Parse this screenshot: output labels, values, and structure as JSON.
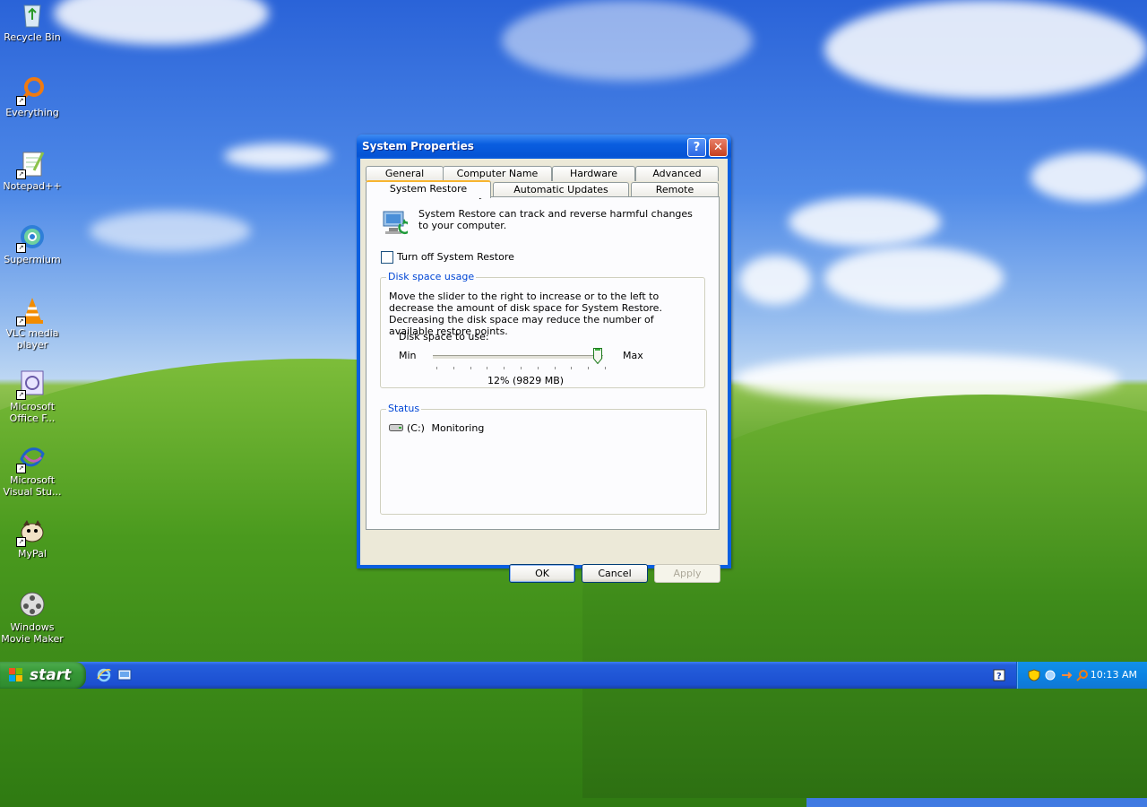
{
  "desktop": {
    "icons": [
      {
        "label": "Recycle Bin",
        "icon": "recycle-bin-icon"
      },
      {
        "label": "Everything",
        "icon": "everything-search-icon"
      },
      {
        "label": "Notepad++",
        "icon": "notepad-plus-plus-icon"
      },
      {
        "label": "Supermium",
        "icon": "supermium-browser-icon"
      },
      {
        "label": "VLC media player",
        "icon": "vlc-cone-icon"
      },
      {
        "label": "Microsoft Office F...",
        "icon": "office-file-icon"
      },
      {
        "label": "Microsoft Visual Stu...",
        "icon": "visual-studio-icon"
      },
      {
        "label": "MyPal",
        "icon": "mypal-browser-icon"
      },
      {
        "label": "Windows Movie Maker",
        "icon": "movie-maker-icon"
      }
    ]
  },
  "window": {
    "title": "System Properties",
    "help_glyph": "?",
    "close_glyph": "✕",
    "tabs_back": [
      {
        "label": "General"
      },
      {
        "label": "Computer Name"
      },
      {
        "label": "Hardware"
      },
      {
        "label": "Advanced"
      }
    ],
    "tabs_front": [
      {
        "label": "System Restore",
        "active": true
      },
      {
        "label": "Automatic Updates"
      },
      {
        "label": "Remote"
      }
    ],
    "intro_text": "System Restore can track and reverse harmful changes to your computer.",
    "turn_off_label": "Turn off System Restore",
    "turn_off_checked": false,
    "disk_group": {
      "title": "Disk space usage",
      "description": "Move the slider to the right to increase or to the left to decrease the amount of disk space for System Restore. Decreasing the disk space may reduce the number of available restore points.",
      "disk_label": "Disk space to use:",
      "min_label": "Min",
      "max_label": "Max",
      "value_label": "12% (9829 MB)",
      "slider_fraction": 0.97
    },
    "status_group": {
      "title": "Status",
      "drive": "(C:)",
      "state": "Monitoring"
    },
    "buttons": {
      "ok": "OK",
      "cancel": "Cancel",
      "apply": "Apply"
    }
  },
  "taskbar": {
    "start_label": "start",
    "clock": "10:13 AM"
  },
  "colors": {
    "title_blue": "#0a5fe0",
    "group_title": "#0046d5",
    "start_green": "#379837",
    "tray_blue": "#0c84e3"
  }
}
